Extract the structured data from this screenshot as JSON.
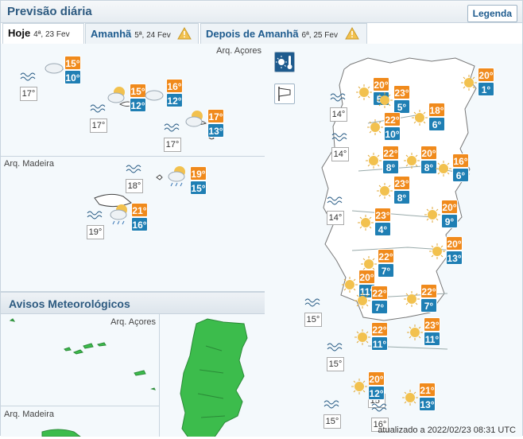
{
  "header": {
    "title": "Previsão diária",
    "legend_label": "Legenda"
  },
  "tabs": [
    {
      "label": "Hoje",
      "date": "4ª, 23 Fev",
      "warning": false
    },
    {
      "label": "Amanhã",
      "date": "5ª, 24 Fev",
      "warning": true
    },
    {
      "label": "Depois de Amanhã",
      "date": "6ª, 25 Fev",
      "warning": true
    }
  ],
  "azores": {
    "label": "Arq. Açores",
    "forecasts": [
      {
        "max": "15°",
        "min": "10°",
        "icon": "cloud-icon"
      },
      {
        "max": "15°",
        "min": "12°",
        "icon": "sun-cloud-icon"
      },
      {
        "max": "16°",
        "min": "12°",
        "icon": "cloud-icon"
      },
      {
        "max": "17°",
        "min": "13°",
        "icon": "sun-cloud-icon"
      }
    ],
    "sea": [
      "17°",
      "17°",
      "17°"
    ]
  },
  "madeira": {
    "label": "Arq. Madeira",
    "forecasts": [
      {
        "max": "19°",
        "min": "15°",
        "icon": "sun-cloud-rain-icon"
      },
      {
        "max": "21°",
        "min": "16°",
        "icon": "sun-cloud-rain-icon"
      }
    ],
    "sea": [
      "18°",
      "19°"
    ]
  },
  "avisos": {
    "title": "Avisos Meteorológicos",
    "azores_label": "Arq. Açores",
    "madeira_label": "Arq. Madeira",
    "warning_color": "#3cbc4c"
  },
  "mainland": {
    "forecasts": [
      {
        "max": "20°",
        "min": "1°"
      },
      {
        "max": "20°",
        "min": "5°"
      },
      {
        "max": "23°",
        "min": "5°"
      },
      {
        "max": "18°",
        "min": "6°"
      },
      {
        "max": "22°",
        "min": "10°"
      },
      {
        "max": "22°",
        "min": "8°"
      },
      {
        "max": "20°",
        "min": "8°"
      },
      {
        "max": "16°",
        "min": "6°"
      },
      {
        "max": "23°",
        "min": "8°"
      },
      {
        "max": "20°",
        "min": "9°"
      },
      {
        "max": "23°",
        "min": "4°"
      },
      {
        "max": "20°",
        "min": "13°"
      },
      {
        "max": "22°",
        "min": "7°"
      },
      {
        "max": "20°",
        "min": "11°"
      },
      {
        "max": "22°",
        "min": "7°"
      },
      {
        "max": "22°",
        "min": "7°"
      },
      {
        "max": "22°",
        "min": "11°"
      },
      {
        "max": "23°",
        "min": "11°"
      },
      {
        "max": "20°",
        "min": "12°"
      },
      {
        "max": "21°",
        "min": "13°"
      }
    ],
    "sea": [
      "14°",
      "14°",
      "14°",
      "15°",
      "15°",
      "15°",
      "15°",
      "16°"
    ]
  },
  "updated": "atualizado a 2022/02/23 08:31 UTC",
  "colors": {
    "max": "#f08a1c",
    "min": "#1f7fb4",
    "accent": "#1e5b8e",
    "land_map": "#ffffff"
  }
}
